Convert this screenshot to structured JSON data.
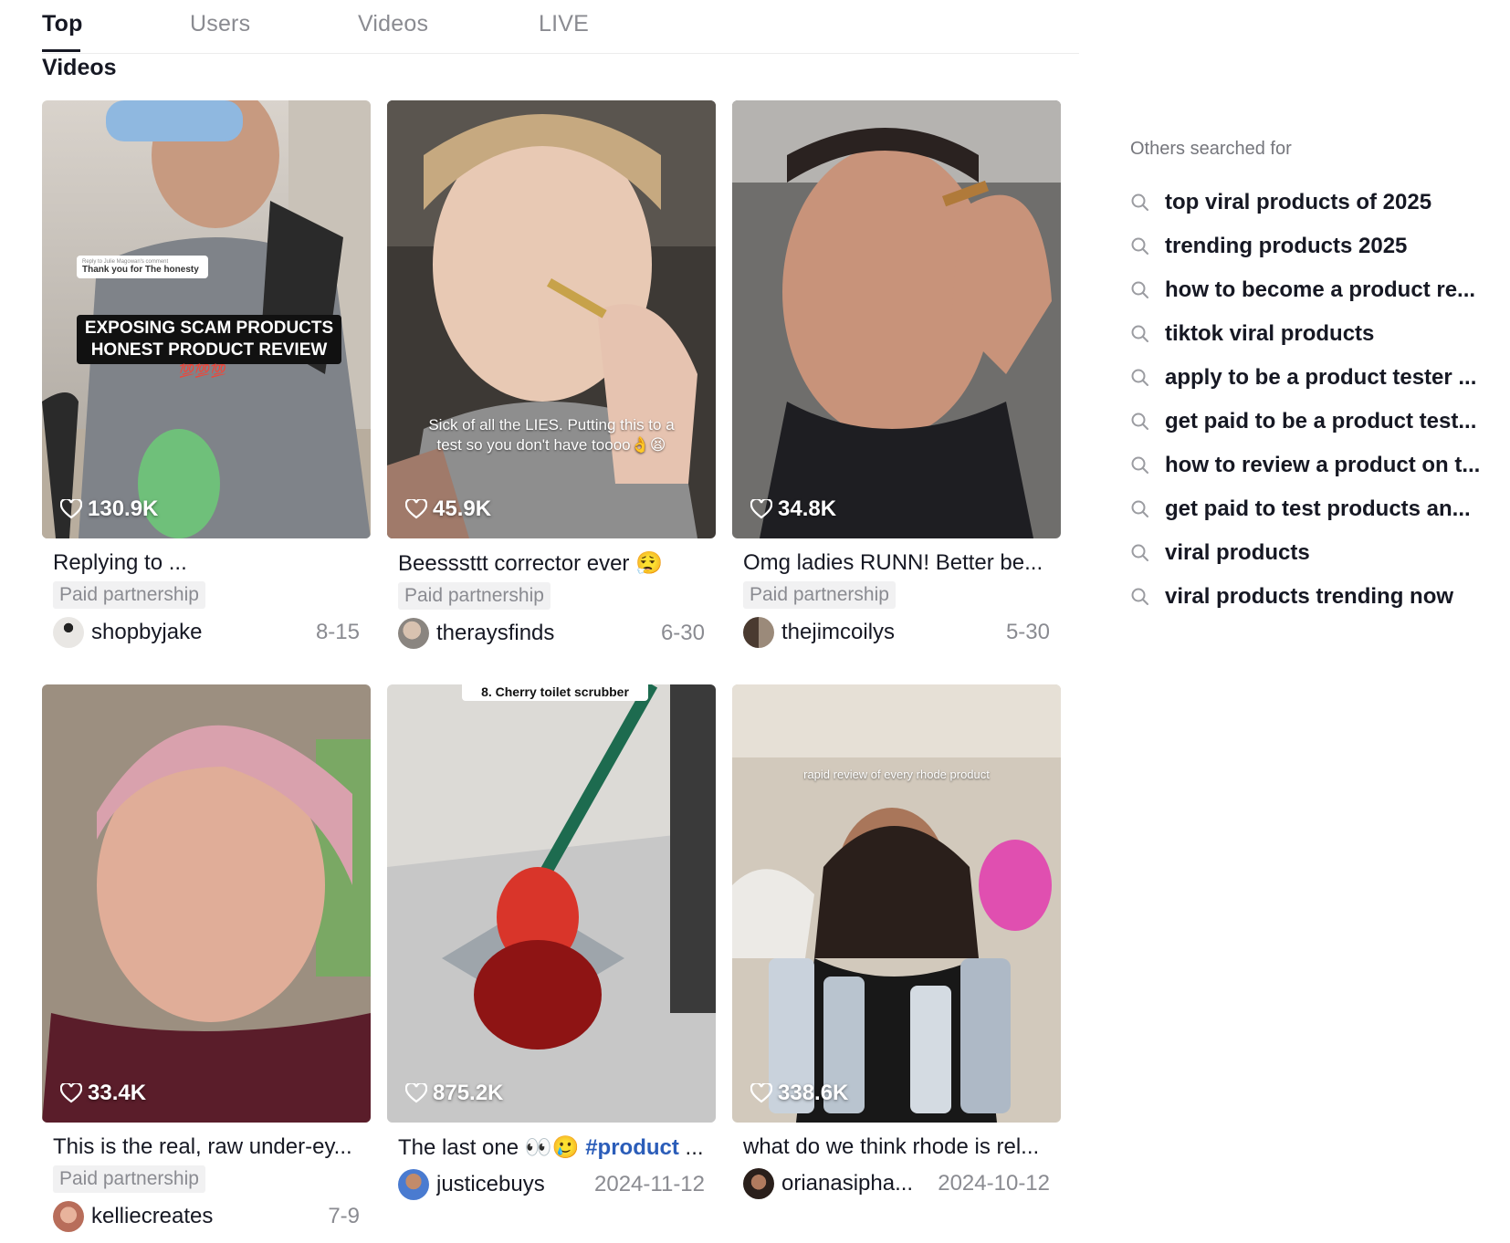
{
  "tabs": [
    {
      "label": "Top",
      "active": true
    },
    {
      "label": "Users",
      "active": false
    },
    {
      "label": "Videos",
      "active": false
    },
    {
      "label": "LIVE",
      "active": false
    }
  ],
  "section_title": "Videos",
  "videos": [
    {
      "likes": "130.9K",
      "caption": "Replying to ...",
      "paid": "Paid partnership",
      "author": "shopbyjake",
      "date": "8-15",
      "overlay_comment_header": "Reply to Julie Magowan's comment",
      "overlay_comment": "Thank you for The honesty",
      "overlay_title": "EXPOSING SCAM PRODUCTS HONEST PRODUCT REVIEW",
      "overlay_emoji": "💯💯💯"
    },
    {
      "likes": "45.9K",
      "caption": "Beesssttt corrector ever 😮‍💨",
      "paid": "Paid partnership",
      "author": "theraysfinds",
      "date": "6-30",
      "overlay_text": "Sick of all the LIES. Putting this to a test so you don't have toooo👌😫"
    },
    {
      "likes": "34.8K",
      "caption": "Omg ladies RUNN! Better be...",
      "paid": "Paid partnership",
      "author": "thejimcoilys",
      "date": "5-30"
    },
    {
      "likes": "33.4K",
      "caption": "This is the real, raw under-ey...",
      "paid": "Paid partnership",
      "author": "kelliecreates",
      "date": "7-9"
    },
    {
      "likes": "875.2K",
      "caption_prefix": "The last one 👀🥲 ",
      "caption_tag": "#product",
      "caption_suffix": " ...",
      "author": "justicebuys",
      "date": "2024-11-12",
      "overlay_text": "8. Cherry toilet scrubber"
    },
    {
      "likes": "338.6K",
      "caption": "what do we think rhode is rel...",
      "author": "orianasipha...",
      "date": "2024-10-12",
      "overlay_text": "rapid review of every rhode product"
    }
  ],
  "sidebar": {
    "title": "Others searched for",
    "items": [
      "top viral products of 2025",
      "trending products 2025",
      "how to become a product re...",
      "tiktok viral products",
      "apply to be a product tester ...",
      "get paid to be a product test...",
      "how to review a product on t...",
      "get paid to test products an...",
      "viral products",
      "viral products trending now"
    ]
  },
  "colors": {
    "text": "#161823",
    "muted": "#8a8b91",
    "hashtag": "#2b5db9",
    "badge_bg": "#f1f1f2"
  }
}
